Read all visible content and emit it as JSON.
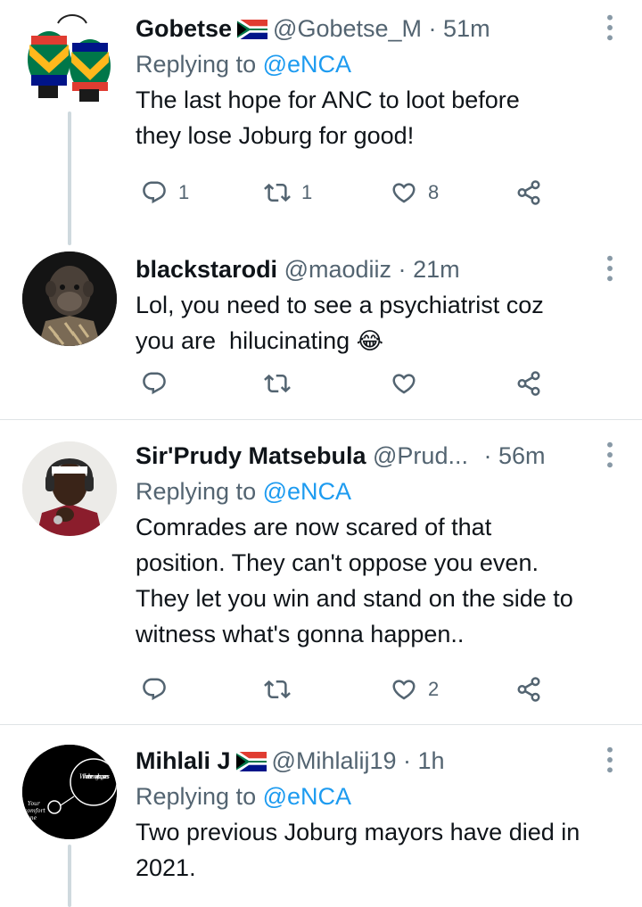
{
  "tweets": [
    {
      "name": "Gobetse",
      "has_flag": true,
      "handle": "@Gobetse_M",
      "separator": "·",
      "time": "51m",
      "replying_prefix": "Replying to ",
      "replying_to": "@eNCA",
      "text_lines": [
        "The last hope for ANC to loot before",
        "they lose Joburg for good!"
      ],
      "counts": {
        "reply": "1",
        "retweet": "1",
        "like": "8"
      },
      "avatar": "boxing-gloves-sa-flag"
    },
    {
      "name": "blackstarodi",
      "handle": "@maodiiz",
      "separator": "·",
      "time": "21m",
      "text_lines": [
        "Lol, you need to see a psychiatrist coz",
        "you are  hilucinating"
      ],
      "emoji": "😂",
      "avatar": "ape-portrait"
    },
    {
      "name": "Sir'Prudy Matsebula",
      "handle": "@Prud...",
      "separator": "·",
      "time": "56m",
      "replying_prefix": "Replying to ",
      "replying_to": "@eNCA",
      "text_lines": [
        "Comrades are now scared of that",
        "position. They can't oppose you even.",
        "They let you win and stand on the side to",
        "witness what's gonna happen.."
      ],
      "counts": {
        "like": "2"
      },
      "avatar": "man-with-headphones"
    },
    {
      "name": "Mihlali J",
      "has_flag": true,
      "handle": "@Mihlalij19",
      "separator": "·",
      "time": "1h",
      "replying_prefix": "Replying to ",
      "replying_to": "@eNCA",
      "text_lines": [
        "Two previous Joburg mayors have died in",
        "2021."
      ],
      "avatar": "comfort-zone-drawing",
      "avatar_text": {
        "big": "Where the magic happens",
        "small1": "Your",
        "small2": "comfort",
        "small3": "zone"
      }
    }
  ],
  "icons": {
    "reply": "reply-icon",
    "retweet": "retweet-icon",
    "like": "heart-icon",
    "share": "share-icon",
    "more": "more-icon"
  },
  "colors": {
    "link": "#1d9bf0",
    "muted": "#536471",
    "text": "#0f1419",
    "thread_line": "#cfd9de"
  }
}
